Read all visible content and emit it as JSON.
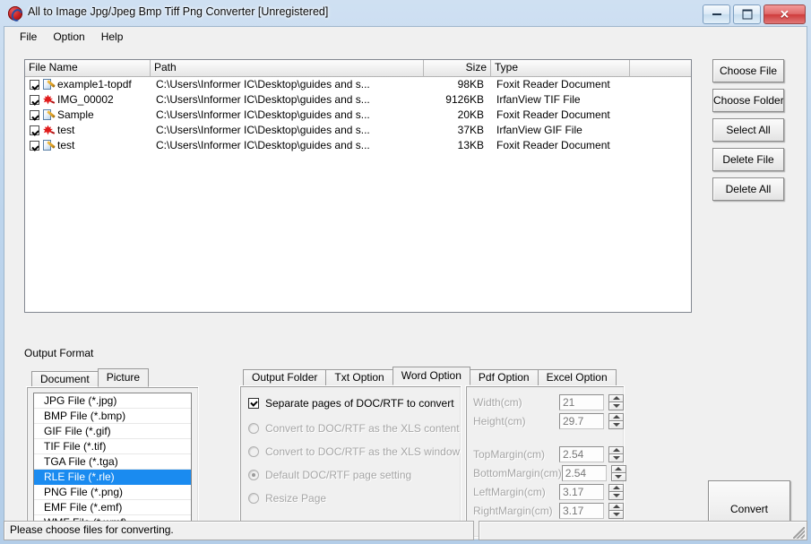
{
  "window": {
    "title": "All to Image Jpg/Jpeg Bmp Tiff Png Converter [Unregistered]",
    "app_icon": "app-logo-icon",
    "minimize_label": "Minimize",
    "maximize_label": "Maximize",
    "close_label": "Close",
    "close_glyph": "✕"
  },
  "menu": {
    "items": [
      {
        "label": "File"
      },
      {
        "label": "Option"
      },
      {
        "label": "Help"
      }
    ]
  },
  "file_list": {
    "columns": [
      "File Name",
      "Path",
      "Size",
      "Type",
      ""
    ],
    "rows": [
      {
        "checked": true,
        "icon": "foxit-document-icon",
        "name": "example1-topdf",
        "path": "C:\\Users\\Informer IC\\Desktop\\guides and s...",
        "size": "98KB",
        "type": "Foxit Reader Document"
      },
      {
        "checked": true,
        "icon": "irfanview-image-icon",
        "name": "IMG_00002",
        "path": "C:\\Users\\Informer IC\\Desktop\\guides and s...",
        "size": "9126KB",
        "type": "IrfanView TIF File"
      },
      {
        "checked": true,
        "icon": "foxit-document-icon",
        "name": "Sample",
        "path": "C:\\Users\\Informer IC\\Desktop\\guides and s...",
        "size": "20KB",
        "type": "Foxit Reader Document"
      },
      {
        "checked": true,
        "icon": "irfanview-image-icon",
        "name": "test",
        "path": "C:\\Users\\Informer IC\\Desktop\\guides and s...",
        "size": "37KB",
        "type": "IrfanView GIF File"
      },
      {
        "checked": true,
        "icon": "foxit-document-icon",
        "name": "test",
        "path": "C:\\Users\\Informer IC\\Desktop\\guides and s...",
        "size": "13KB",
        "type": "Foxit Reader Document"
      }
    ]
  },
  "side_buttons": [
    {
      "label": "Choose File"
    },
    {
      "label": "Choose Folder"
    },
    {
      "label": "Select All"
    },
    {
      "label": "Delete File"
    },
    {
      "label": "Delete All"
    }
  ],
  "output_format": {
    "group_label": "Output Format",
    "tabs": [
      {
        "label": "Document",
        "selected": false
      },
      {
        "label": "Picture",
        "selected": true
      }
    ],
    "items": [
      {
        "label": "JPG File  (*.jpg)",
        "selected": false
      },
      {
        "label": "BMP File  (*.bmp)",
        "selected": false
      },
      {
        "label": "GIF File  (*.gif)",
        "selected": false
      },
      {
        "label": "TIF File  (*.tif)",
        "selected": false
      },
      {
        "label": "TGA File  (*.tga)",
        "selected": false
      },
      {
        "label": "RLE File  (*.rle)",
        "selected": true
      },
      {
        "label": "PNG File  (*.png)",
        "selected": false
      },
      {
        "label": "EMF File  (*.emf)",
        "selected": false
      },
      {
        "label": "WMF File  (*.wmf)",
        "selected": false
      }
    ],
    "selected_color": "#1a8bf0"
  },
  "option_tabs": [
    {
      "label": "Output Folder",
      "selected": false
    },
    {
      "label": "Txt Option",
      "selected": false
    },
    {
      "label": "Word Option",
      "selected": true
    },
    {
      "label": "Pdf Option",
      "selected": false
    },
    {
      "label": "Excel Option",
      "selected": false
    }
  ],
  "word_option": {
    "checkbox": {
      "label": "Separate pages of DOC/RTF to convert",
      "checked": true,
      "enabled": true
    },
    "radios": [
      {
        "label": "Convert to DOC/RTF as the XLS content",
        "selected": false,
        "enabled": false
      },
      {
        "label": "Convert to DOC/RTF as the XLS window",
        "selected": false,
        "enabled": false
      },
      {
        "label": "Default DOC/RTF page setting",
        "selected": true,
        "enabled": false
      },
      {
        "label": "Resize Page",
        "selected": false,
        "enabled": false
      }
    ]
  },
  "page_setup": {
    "fields": [
      {
        "label": "Width(cm)",
        "value": "21"
      },
      {
        "label": "Height(cm)",
        "value": "29.7"
      },
      {
        "label": "TopMargin(cm)",
        "value": "2.54"
      },
      {
        "label": "BottomMargin(cm)",
        "value": "2.54"
      },
      {
        "label": "LeftMargin(cm)",
        "value": "3.17"
      },
      {
        "label": "RightMargin(cm)",
        "value": "3.17"
      }
    ]
  },
  "convert_button": {
    "label": "Convert"
  },
  "statusbar": {
    "message": "Please choose files for converting.",
    "right_message": ""
  }
}
